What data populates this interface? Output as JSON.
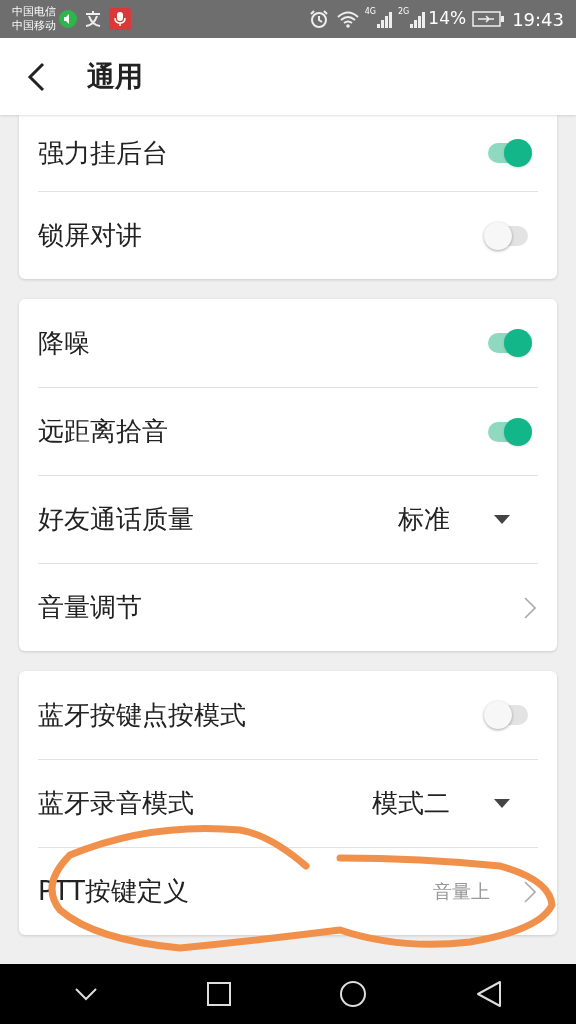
{
  "status_bar": {
    "carriers": [
      "中国电信",
      "中国移动"
    ],
    "network_1": "4G",
    "network_2": "2G",
    "battery": "14%",
    "time": "19:43"
  },
  "header": {
    "title": "通用"
  },
  "groups": [
    {
      "rows": [
        {
          "kind": "toggle",
          "label": "强力挂后台",
          "on": true
        },
        {
          "kind": "toggle",
          "label": "锁屏对讲",
          "on": false
        }
      ]
    },
    {
      "rows": [
        {
          "kind": "toggle",
          "label": "降噪",
          "on": true
        },
        {
          "kind": "toggle",
          "label": "远距离拾音",
          "on": true
        },
        {
          "kind": "dropdown",
          "label": "好友通话质量",
          "value": "标准"
        },
        {
          "kind": "link",
          "label": "音量调节"
        }
      ]
    },
    {
      "rows": [
        {
          "kind": "toggle",
          "label": "蓝牙按键点按模式",
          "on": false
        },
        {
          "kind": "dropdown",
          "label": "蓝牙录音模式",
          "value": "模式二"
        },
        {
          "kind": "link",
          "label": "PTT按键定义",
          "value": "音量上"
        }
      ]
    }
  ]
}
